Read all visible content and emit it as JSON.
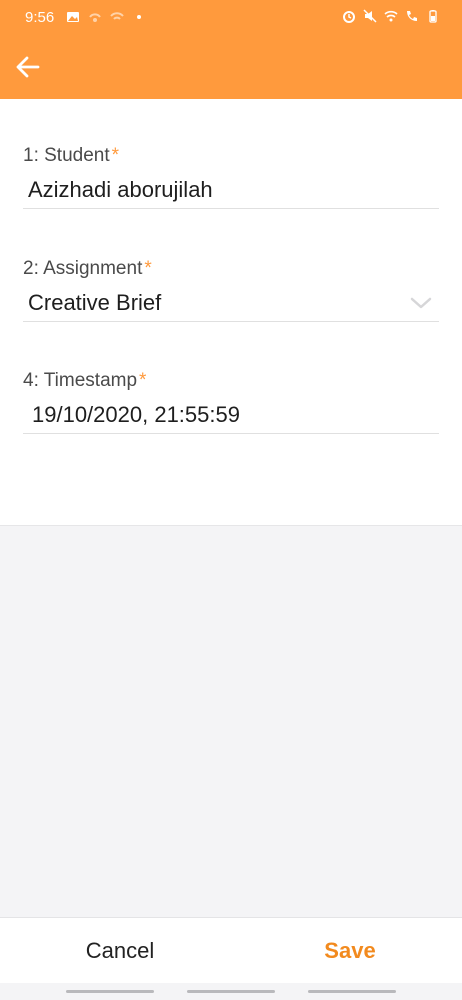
{
  "status_bar": {
    "time": "9:56",
    "left_icons": [
      "gallery-icon",
      "signal-dim-icon",
      "wifi-dim-icon",
      "dot-icon"
    ],
    "right_icons": [
      "alarm-icon",
      "mute-icon",
      "wifi-icon",
      "call-signal-icon",
      "battery-icon"
    ]
  },
  "app_bar": {
    "color": "#ff9a3d",
    "back_icon": "arrow-left-icon"
  },
  "form": {
    "fields": [
      {
        "label": "1: Student",
        "required_mark": "*",
        "value": "Azizhadi aborujilah"
      },
      {
        "label": "2: Assignment",
        "required_mark": "*",
        "value": "Creative Brief",
        "dropdown": true
      },
      {
        "label": "4: Timestamp",
        "required_mark": "*",
        "value": "19/10/2020, 21:55:59"
      }
    ]
  },
  "actions": {
    "cancel_label": "Cancel",
    "save_label": "Save",
    "save_color": "#f28a1e"
  }
}
